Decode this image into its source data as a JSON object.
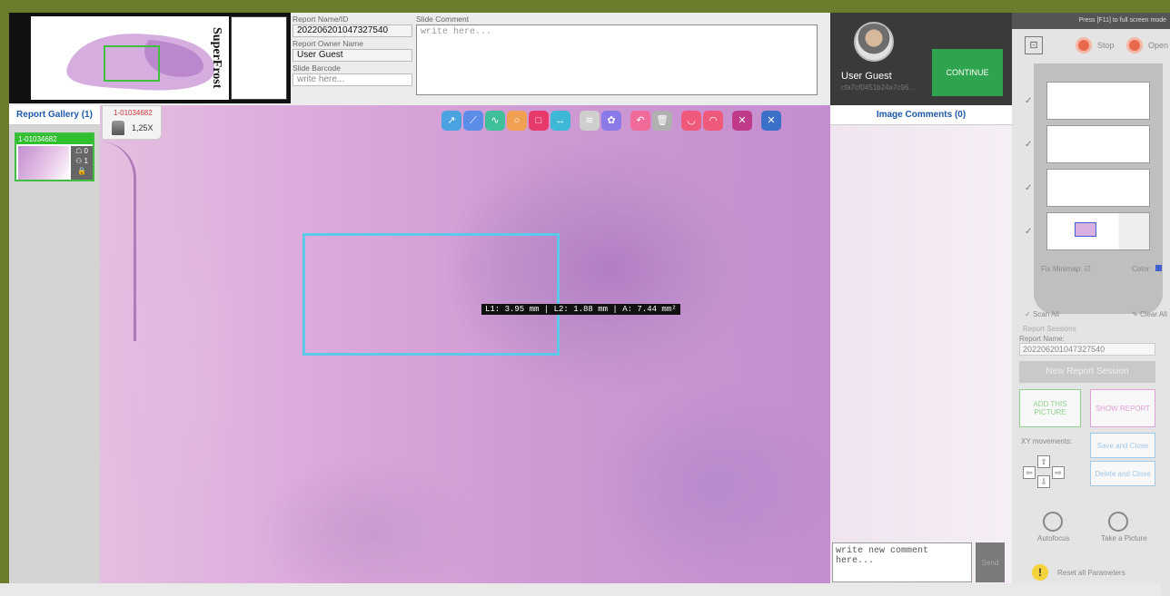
{
  "slide": {
    "label_text": "SuperFrost"
  },
  "report": {
    "name_label": "Report Name/ID",
    "name_value": "202206201047327540",
    "owner_label": "Report Owner Name",
    "owner_value": "User Guest",
    "barcode_label": "Slide Barcode",
    "barcode_placeholder": "write here...",
    "comment_label": "Slide Comment",
    "comment_placeholder": "write here..."
  },
  "user": {
    "name": "User Guest",
    "id": "cfa7cf0451b24a7c96...",
    "continue_label": "CONTINUE"
  },
  "gallery": {
    "title": "Report Gallery (1)",
    "items": [
      {
        "id": "1-01034682",
        "count_a": "0",
        "count_b": "1"
      }
    ]
  },
  "viewer": {
    "slide_id": "1-01034682",
    "zoom": "1,25X",
    "measurement": "L1: 3.95 mm | L2: 1.88 mm | A: 7.44 mm²",
    "tools": [
      {
        "name": "arrow-tool-icon",
        "glyph": "↗",
        "color": "#4aa3e0"
      },
      {
        "name": "line-tool-icon",
        "glyph": "⟋",
        "color": "#5b8de8"
      },
      {
        "name": "freehand-tool-icon",
        "glyph": "∿",
        "color": "#3fbf9a"
      },
      {
        "name": "circle-tool-icon",
        "glyph": "○",
        "color": "#f0a050"
      },
      {
        "name": "rectangle-tool-icon",
        "glyph": "□",
        "color": "#e83a6a"
      },
      {
        "name": "ruler-tool-icon",
        "glyph": "↔",
        "color": "#3fb8d8"
      },
      {
        "name": "layers-icon",
        "glyph": "≋",
        "color": "#cfcfcf"
      },
      {
        "name": "color-palette-icon",
        "glyph": "✿",
        "color": "#8a7ae8"
      },
      {
        "name": "undo-icon",
        "glyph": "↶",
        "color": "#f06a9a"
      },
      {
        "name": "trash-icon",
        "glyph": "🗑",
        "color": "#b0b0b0"
      },
      {
        "name": "hide-annotations-icon",
        "glyph": "◡",
        "color": "#f05a7a"
      },
      {
        "name": "show-annotations-icon",
        "glyph": "◠",
        "color": "#f05a7a"
      },
      {
        "name": "collapse-icon",
        "glyph": "✕",
        "color": "#c03a8a"
      },
      {
        "name": "close-viewer-icon",
        "glyph": "✕",
        "color": "#3a70c8"
      }
    ]
  },
  "comments": {
    "title": "Image Comments (0)",
    "input_placeholder": "write new comment here...",
    "send_label": "Send"
  },
  "right_panel": {
    "fullscreen_hint": "Press [F11] to full screen mode",
    "stop_label": "Stop",
    "open_label": "Open",
    "slot_numbers": [
      "4",
      "3",
      "2",
      "1"
    ],
    "fix_minimap_label": "Fix Minimap: ☑",
    "color_label": "Color:",
    "scan_all_label": "Scan All",
    "clear_all_label": "Clear All",
    "sessions_label": "Report Sessions",
    "report_name_label": "Report Name:",
    "report_name_value": "202206201047327540",
    "new_session_label": "New Report Session",
    "add_picture_label": "ADD THIS PICTURE",
    "show_report_label": "SHOW REPORT",
    "xy_label": "XY movements:",
    "save_close_label": "Save and Close",
    "delete_close_label": "Delete and Close",
    "autofocus_label": "Autofocus",
    "take_picture_label": "Take a Picture",
    "reset_label": "Reset all Parameters"
  }
}
